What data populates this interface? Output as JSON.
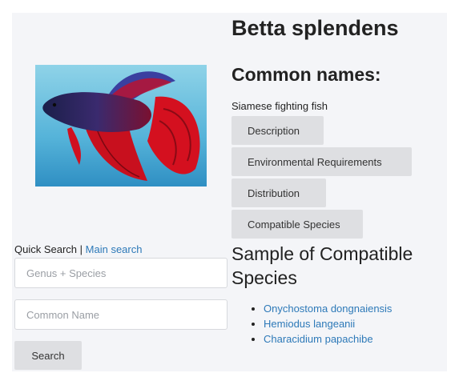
{
  "species": {
    "title": "Betta splendens",
    "image_alt": "Betta splendens fish photo"
  },
  "common_names": {
    "heading": "Common names:",
    "value": "Siamese fighting fish"
  },
  "tabs": [
    {
      "label": "Description"
    },
    {
      "label": "Environmental Requirements"
    },
    {
      "label": "Distribution"
    },
    {
      "label": "Compatible Species"
    }
  ],
  "quick_search": {
    "label": "Quick Search",
    "separator": " | ",
    "main_search_link": "Main search",
    "genus_placeholder": "Genus + Species",
    "common_placeholder": "Common Name",
    "button_label": "Search"
  },
  "compatible": {
    "heading": "Sample of Compatible Species",
    "items": [
      {
        "name": "Onychostoma dongnaiensis"
      },
      {
        "name": "Hemiodus langeanii"
      },
      {
        "name": "Characidium papachibe"
      }
    ]
  },
  "colors": {
    "panel_bg": "#f4f5f8",
    "button_bg": "#dedfe2",
    "link": "#2d79b8"
  }
}
